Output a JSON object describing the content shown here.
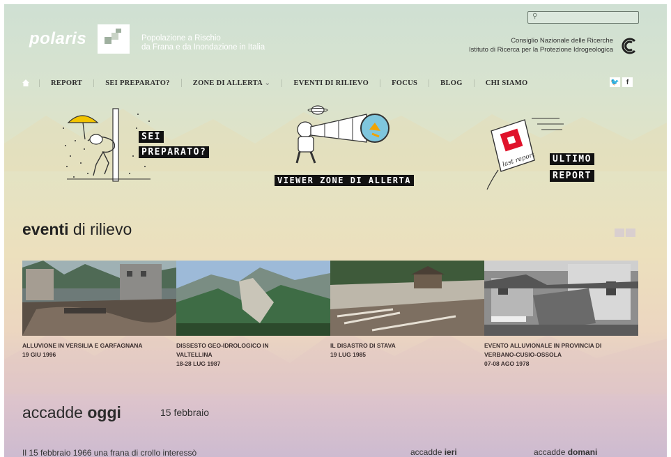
{
  "header": {
    "search_placeholder": "",
    "logo_text": "polaris",
    "tagline_line1": "Popolazione a Rischio",
    "tagline_line2": "da Frana e da Inondazione in Italia",
    "institution_line1": "Consiglio Nazionale delle Ricerche",
    "institution_line2": "Istituto di Ricerca per la Protezione Idrogeologica"
  },
  "nav": {
    "items": [
      "REPORT",
      "SEI PREPARATO?",
      "ZONE DI ALLERTA",
      "EVENTI DI RILIEVO",
      "FOCUS",
      "BLOG",
      "CHI SIAMO"
    ],
    "dropdown_arrow": "⌄",
    "social": [
      "twitter-icon",
      "facebook-icon"
    ]
  },
  "promos": {
    "prepared_line1": "SEI",
    "prepared_line2": "PREPARATO?",
    "viewer": "VIEWER ZONE DI ALLERTA",
    "report_line1": "ULTIMO",
    "report_line2": "REPORT",
    "report_badge": "last report"
  },
  "eventi": {
    "title_bold": "eventi",
    "title_rest": " di rilievo",
    "cards": [
      {
        "title": "ALLUVIONE IN VERSILIA E GARFAGNANA",
        "date": "19 GIU 1996"
      },
      {
        "title": "DISSESTO GEO-IDROLOGICO IN VALTELLINA",
        "date": "18-28 LUG 1987"
      },
      {
        "title": "IL DISASTRO DI STAVA",
        "date": "19 LUG 1985"
      },
      {
        "title": "EVENTO ALLUVIONALE IN PROVINCIA DI VERBANO-CUSIO-OSSOLA",
        "date": "07-08 AGO 1978"
      }
    ]
  },
  "accadde": {
    "title_rest": "accadde ",
    "title_bold": "oggi",
    "date": "15 febbraio",
    "snippet": "Il 15 febbraio 1966 una frana di crollo interessò",
    "ieri_rest": "accadde ",
    "ieri_bold": "ieri",
    "domani_rest": "accadde ",
    "domani_bold": "domani"
  },
  "colors": {
    "accent": "#111111",
    "text": "#2c2c2c"
  }
}
